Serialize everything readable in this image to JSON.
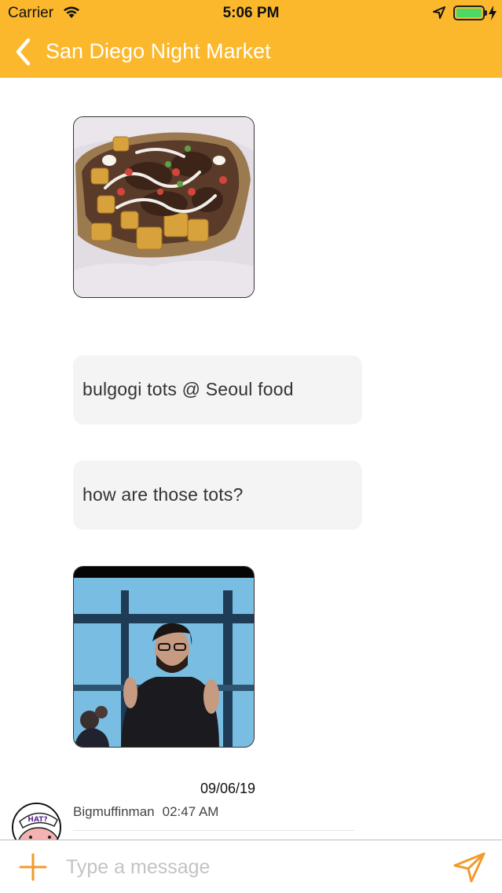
{
  "status_bar": {
    "carrier": "Carrier",
    "time": "5:06 PM",
    "battery_level": 1.0
  },
  "nav": {
    "title": "San Diego Night Market",
    "back_icon": "chevron-left-icon"
  },
  "messages": [
    {
      "type": "image",
      "depicts": "food-photo"
    },
    {
      "type": "text",
      "text": "bulgogi tots @ Seoul food"
    },
    {
      "type": "text",
      "text": "how are those tots?"
    },
    {
      "type": "image",
      "depicts": "gif-photo"
    }
  ],
  "divider_date": "09/06/19",
  "next_message": {
    "sender": "Bigmuffinman",
    "time": "02:47 AM"
  },
  "composer": {
    "placeholder": "Type a message",
    "attach_icon": "plus-icon",
    "send_icon": "send-icon"
  },
  "colors": {
    "header": "#fbb82c",
    "accent": "#f39a2b",
    "bubble": "#f4f4f4"
  }
}
